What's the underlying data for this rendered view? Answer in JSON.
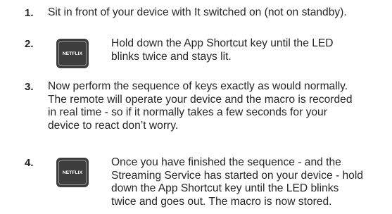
{
  "steps": [
    {
      "number": "1.",
      "lines": [
        "Sit in front of your device with It switched on (not on standby)."
      ]
    },
    {
      "number": "2.",
      "key_label": "NETFLIX",
      "lines": [
        "Hold down the App Shortcut key until the LED",
        "blinks twice and stays lit."
      ]
    },
    {
      "number": "3.",
      "lines": [
        "Now perform the sequence of keys exactly as would normally.",
        "The remote will operate your device and the macro is recorded",
        "in real time - so if it normally takes a few seconds for your",
        "device to react don’t worry."
      ]
    },
    {
      "number": "4.",
      "key_label": "NETFLIX",
      "lines": [
        "Once you have finished the sequence - and the",
        "Streaming Service has started on your device - hold",
        "down the App Shortcut key until the LED blinks",
        "twice and goes out. The macro is now stored."
      ]
    }
  ]
}
